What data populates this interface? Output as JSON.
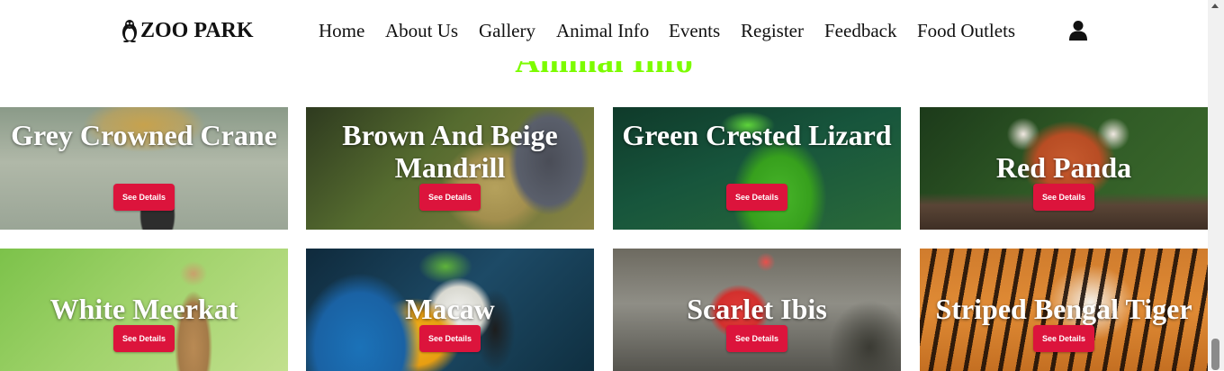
{
  "navbar": {
    "brand": "ZOO PARK",
    "brand_icon": "penguin-icon",
    "links": [
      "Home",
      "About Us",
      "Gallery",
      "Animal Info",
      "Events",
      "Register",
      "Feedback",
      "Food Outlets"
    ],
    "user_icon": "user-icon"
  },
  "section": {
    "title": "Animal Info",
    "title_color": "#7cfc00"
  },
  "cards": [
    {
      "title": "Grey Crowned Crane",
      "button": "See Details"
    },
    {
      "title": "Brown And Beige Mandrill",
      "button": "See Details"
    },
    {
      "title": "Green Crested Lizard",
      "button": "See Details"
    },
    {
      "title": "Red Panda",
      "button": "See Details"
    },
    {
      "title": "White Meerkat",
      "button": "See Details"
    },
    {
      "title": "Macaw",
      "button": "See Details"
    },
    {
      "title": "Scarlet Ibis",
      "button": "See Details"
    },
    {
      "title": "Striped Bengal Tiger",
      "button": "See Details"
    }
  ],
  "colors": {
    "button": "#dc143c",
    "title_text": "#ffffff"
  }
}
